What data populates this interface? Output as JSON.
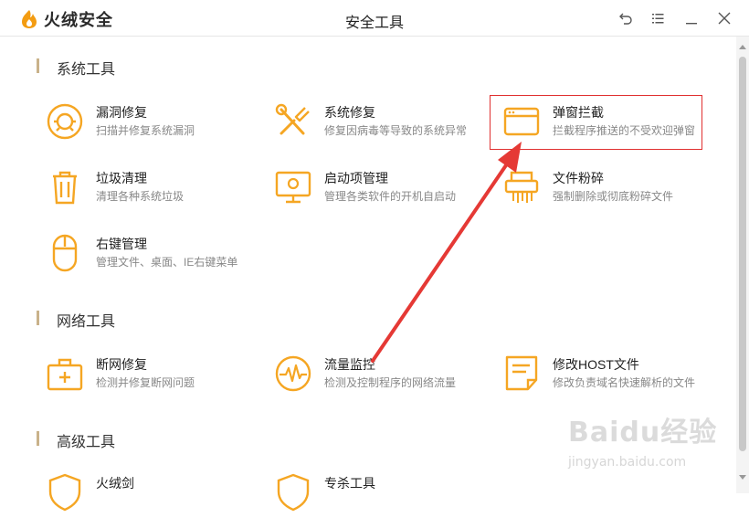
{
  "app": {
    "brand_name": "火绒安全",
    "window_title": "安全工具"
  },
  "colors": {
    "accent": "#f5a623",
    "highlight_border": "#e03030",
    "arrow": "#e53935"
  },
  "window_controls": [
    {
      "name": "back-icon"
    },
    {
      "name": "menu-icon"
    },
    {
      "name": "minimize-icon"
    },
    {
      "name": "close-icon"
    }
  ],
  "sections": {
    "system": {
      "title": "系统工具",
      "tools": [
        {
          "name": "漏洞修复",
          "desc": "扫描并修复系统漏洞",
          "icon": "vulnerability-fix-icon"
        },
        {
          "name": "系统修复",
          "desc": "修复因病毒等导致的系统异常",
          "icon": "system-repair-icon"
        },
        {
          "name": "弹窗拦截",
          "desc": "拦截程序推送的不受欢迎弹窗",
          "icon": "popup-block-icon"
        },
        {
          "name": "垃圾清理",
          "desc": "清理各种系统垃圾",
          "icon": "trash-icon"
        },
        {
          "name": "启动项管理",
          "desc": "管理各类软件的开机自启动",
          "icon": "startup-monitor-icon"
        },
        {
          "name": "文件粉碎",
          "desc": "强制删除或彻底粉碎文件",
          "icon": "shredder-icon"
        },
        {
          "name": "右键管理",
          "desc": "管理文件、桌面、IE右键菜单",
          "icon": "mouse-icon"
        }
      ]
    },
    "network": {
      "title": "网络工具",
      "tools": [
        {
          "name": "断网修复",
          "desc": "检测并修复断网问题",
          "icon": "first-aid-icon"
        },
        {
          "name": "流量监控",
          "desc": "检测及控制程序的网络流量",
          "icon": "traffic-monitor-icon"
        },
        {
          "name": "修改HOST文件",
          "desc": "修改负责域名快速解析的文件",
          "icon": "host-file-icon"
        }
      ]
    },
    "advanced": {
      "title": "高级工具",
      "tools": [
        {
          "name": "火绒剑",
          "icon": "shield-icon"
        },
        {
          "name": "专杀工具",
          "icon": "shield-icon"
        }
      ]
    }
  },
  "watermark": {
    "logo": "Baidu经验",
    "url": "jingyan.baidu.com"
  }
}
